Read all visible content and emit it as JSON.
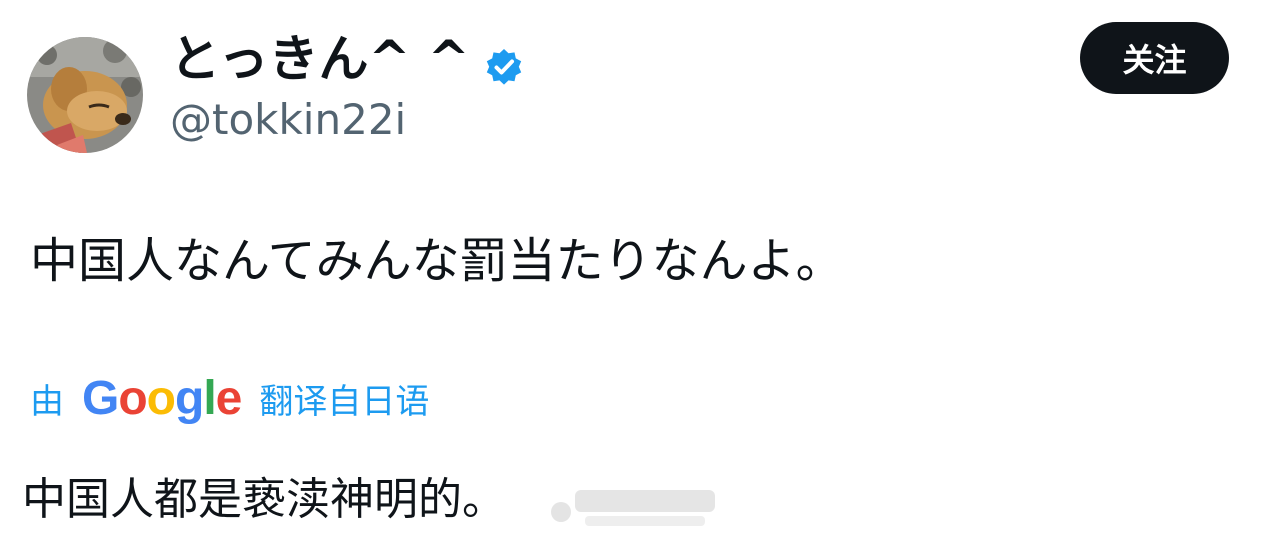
{
  "user": {
    "display_name": "とっきん^ ^",
    "handle": "@tokkin22i",
    "verified": true,
    "verified_color": "#1d9bf0"
  },
  "follow_button": {
    "label": "关注"
  },
  "tweet": {
    "text": "中国人なんてみんな罰当たりなんよ。"
  },
  "translation": {
    "by_label": "由",
    "provider": "Google",
    "suffix_label": "翻译自日语",
    "text": "中国人都是亵渎神明的。"
  },
  "icons": {
    "verified": "verified-badge-icon",
    "avatar": "dog-avatar"
  },
  "colors": {
    "link_blue": "#1d9bf0",
    "button_bg": "#0f1419",
    "handle_gray": "#536471"
  }
}
